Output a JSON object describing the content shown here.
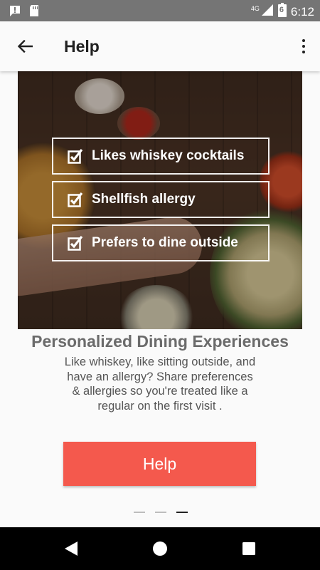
{
  "status_bar": {
    "network": "4G",
    "battery_level": "6",
    "time": "6:12"
  },
  "app_bar": {
    "title": "Help"
  },
  "hero": {
    "checklist": [
      "Likes whiskey cocktails",
      "Shellfish allergy",
      "Prefers to dine outside"
    ]
  },
  "content": {
    "heading": "Personalized Dining Experiences",
    "description": "Like whiskey, like sitting outside, and have an allergy? Share preferences & allergies so you're treated like a regular on the first visit ."
  },
  "cta": {
    "label": "Help",
    "color": "#f4594d"
  },
  "pager": {
    "total": 3,
    "active_index": 2
  },
  "icons": {
    "status_left": [
      "alert-icon",
      "sd-card-icon"
    ],
    "status_right": [
      "signal-icon",
      "battery-icon"
    ],
    "app_bar": [
      "back-arrow-icon",
      "more-vert-icon"
    ],
    "nav": [
      "back-triangle-icon",
      "home-circle-icon",
      "recents-square-icon"
    ]
  }
}
